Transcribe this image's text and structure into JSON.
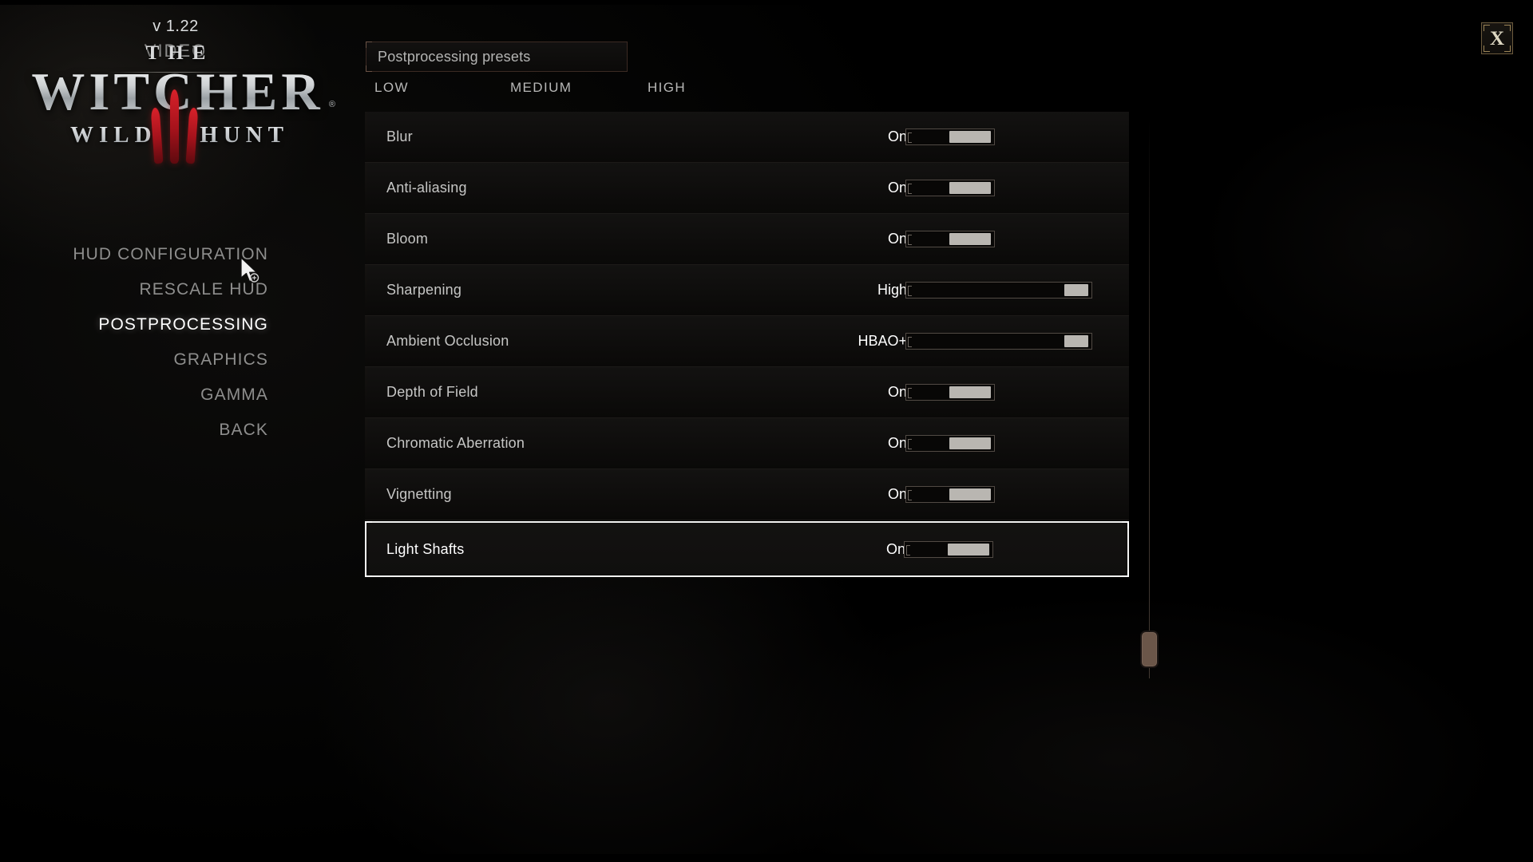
{
  "game": {
    "logo_the": "THE",
    "logo_witcher": "WITCHER",
    "logo_wild": "WILD",
    "logo_hunt": "HUNT",
    "logo_numeral": "III",
    "registered_mark": "®",
    "version": "v 1.22",
    "section_title": "VIDEO"
  },
  "nav": {
    "items": [
      {
        "label": "HUD CONFIGURATION",
        "active": false
      },
      {
        "label": "RESCALE HUD",
        "active": false
      },
      {
        "label": "POSTPROCESSING",
        "active": true
      },
      {
        "label": "GRAPHICS",
        "active": false
      },
      {
        "label": "GAMMA",
        "active": false
      },
      {
        "label": "BACK",
        "active": false
      }
    ]
  },
  "presets": {
    "label": "Postprocessing presets",
    "tiers": [
      "LOW",
      "MEDIUM",
      "HIGH"
    ]
  },
  "settings": {
    "rows": [
      {
        "label": "Blur",
        "value": "On",
        "states": 2,
        "selected": false
      },
      {
        "label": "Anti-aliasing",
        "value": "On",
        "states": 2,
        "selected": false
      },
      {
        "label": "Bloom",
        "value": "On",
        "states": 2,
        "selected": false
      },
      {
        "label": "Sharpening",
        "value": "High",
        "states": 3,
        "selected": false
      },
      {
        "label": "Ambient Occlusion",
        "value": "HBAO+",
        "states": 3,
        "selected": false
      },
      {
        "label": "Depth of Field",
        "value": "On",
        "states": 2,
        "selected": false
      },
      {
        "label": "Chromatic Aberration",
        "value": "On",
        "states": 2,
        "selected": false
      },
      {
        "label": "Vignetting",
        "value": "On",
        "states": 2,
        "selected": false
      },
      {
        "label": "Light Shafts",
        "value": "On",
        "states": 2,
        "selected": true
      }
    ]
  },
  "close_button": {
    "label": "X"
  },
  "colors": {
    "background": "#000000",
    "row_background": "#121110",
    "text_primary": "#ffffff",
    "text_muted": "#8e8e8d",
    "slider_fill": "#b9b6b1",
    "accent_gold": "#9b8456",
    "accent_brown": "#6b5649",
    "logo_red": "#a3121b"
  }
}
